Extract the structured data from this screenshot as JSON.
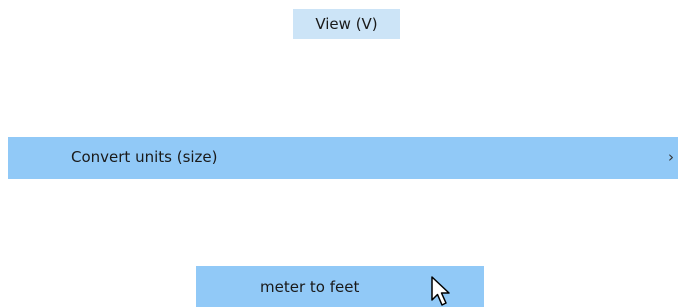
{
  "menu": {
    "view_label": "View (V)",
    "convert_units_label": "Convert units (size)",
    "convert_units_submenu_icon": "chevron-right-icon",
    "meter_to_feet_label": "meter to feet"
  },
  "colors": {
    "view_highlight": "#cce4f7",
    "item_highlight": "#91c9f7"
  },
  "cursor": {
    "icon": "arrow-pointer-icon"
  }
}
